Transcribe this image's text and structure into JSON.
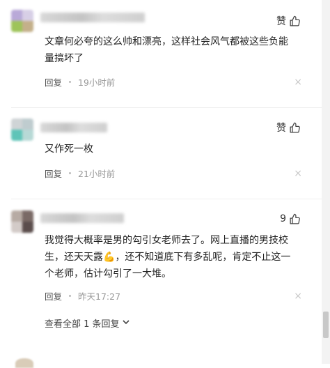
{
  "colors": {
    "text": "#222222",
    "meta": "#999999",
    "divider": "#eeeeee"
  },
  "comments": [
    {
      "like_label": "赞",
      "content": "文章何必夸的这么帅和漂亮，这样社会风气都被这些负能量搞坏了",
      "reply_label": "回复",
      "time": "19小时前",
      "close_glyph": "×"
    },
    {
      "like_label": "赞",
      "content": "又作死一枚",
      "reply_label": "回复",
      "time": "21小时前",
      "close_glyph": "×"
    },
    {
      "like_label": "9",
      "content_before": "我觉得大概率是男的勾引女老师去了。网上直播的男技校生，还天天露",
      "content_emoji": "💪",
      "content_after": "，还不知道底下有多乱呢，肯定不止这一个老师，估计勾引了一大堆。",
      "reply_label": "回复",
      "time": "昨天17:27",
      "close_glyph": "×"
    }
  ],
  "view_all": {
    "label": "查看全部 1 条回复"
  },
  "icons": {
    "like": "thumbs-up-icon",
    "close": "close-icon",
    "expand": "chevron-down-icon"
  }
}
